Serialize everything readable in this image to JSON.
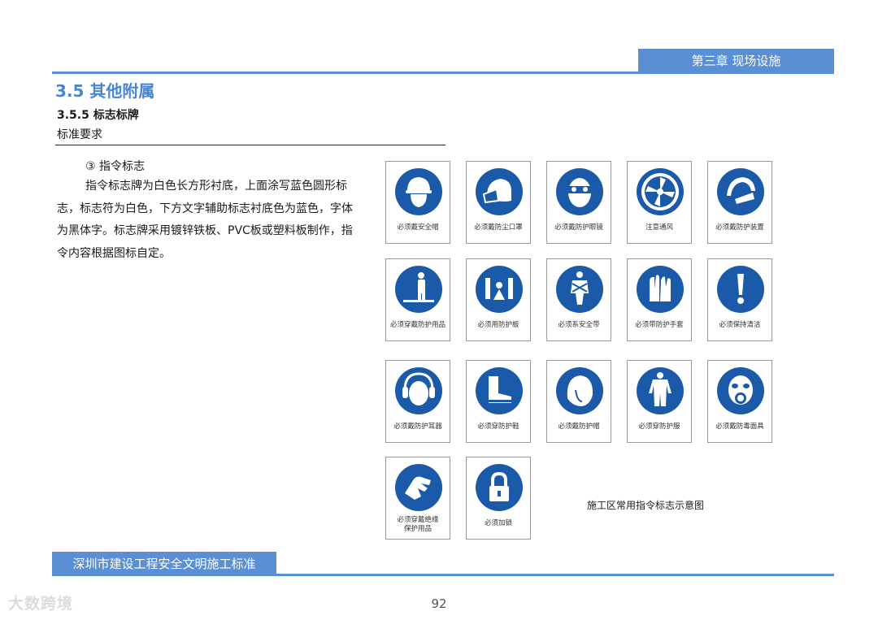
{
  "header": {
    "chapter": "第三章 现场设施"
  },
  "section": {
    "title": "3.5 其他附属",
    "subsection": "3.5.5 标志标牌",
    "label": "标准要求"
  },
  "content": {
    "item_title": "③ 指令标志",
    "body": "指令标志牌为白色长方形衬底，上面涂写蓝色圆形标志，标志符为白色，下方文字辅助标志衬底色为蓝色，字体为黑体字。标志牌采用镀锌铁板、PVC板或塑料板制作，指令内容根据图标自定。"
  },
  "signs": [
    {
      "label": "必须戴安全帽",
      "icon": "helmet-icon"
    },
    {
      "label": "必须戴防尘口罩",
      "icon": "dust-mask-icon"
    },
    {
      "label": "必须戴防护眼镜",
      "icon": "goggles-icon"
    },
    {
      "label": "注意通风",
      "icon": "ventilation-icon"
    },
    {
      "label": "必须戴防护装置",
      "icon": "face-shield-icon"
    },
    {
      "label": "必须穿戴防护用品",
      "icon": "protective-gear-icon"
    },
    {
      "label": "必须用防护板",
      "icon": "guard-board-icon"
    },
    {
      "label": "必须系安全带",
      "icon": "safety-harness-icon"
    },
    {
      "label": "必须带防护手套",
      "icon": "gloves-icon"
    },
    {
      "label": "必须保持清洁",
      "icon": "exclamation-icon"
    },
    {
      "label": "必须戴防护耳器",
      "icon": "ear-protector-icon"
    },
    {
      "label": "必须穿防护鞋",
      "icon": "safety-boots-icon"
    },
    {
      "label": "必须戴防护帽",
      "icon": "protective-cap-icon"
    },
    {
      "label": "必须穿防护服",
      "icon": "protective-suit-icon"
    },
    {
      "label": "必须戴防毒面具",
      "icon": "gas-mask-icon"
    },
    {
      "label": "必须穿戴绝缘保护用品",
      "icon": "insulating-glove-icon"
    },
    {
      "label": "必须加锁",
      "icon": "padlock-icon"
    }
  ],
  "caption": "施工区常用指令标志示意图",
  "footer": {
    "title": "深圳市建设工程安全文明施工标准",
    "page": "92"
  },
  "watermark": "大数跨境",
  "colors": {
    "accent": "#5b8fd3",
    "sign_blue": "#1a5aa8"
  }
}
